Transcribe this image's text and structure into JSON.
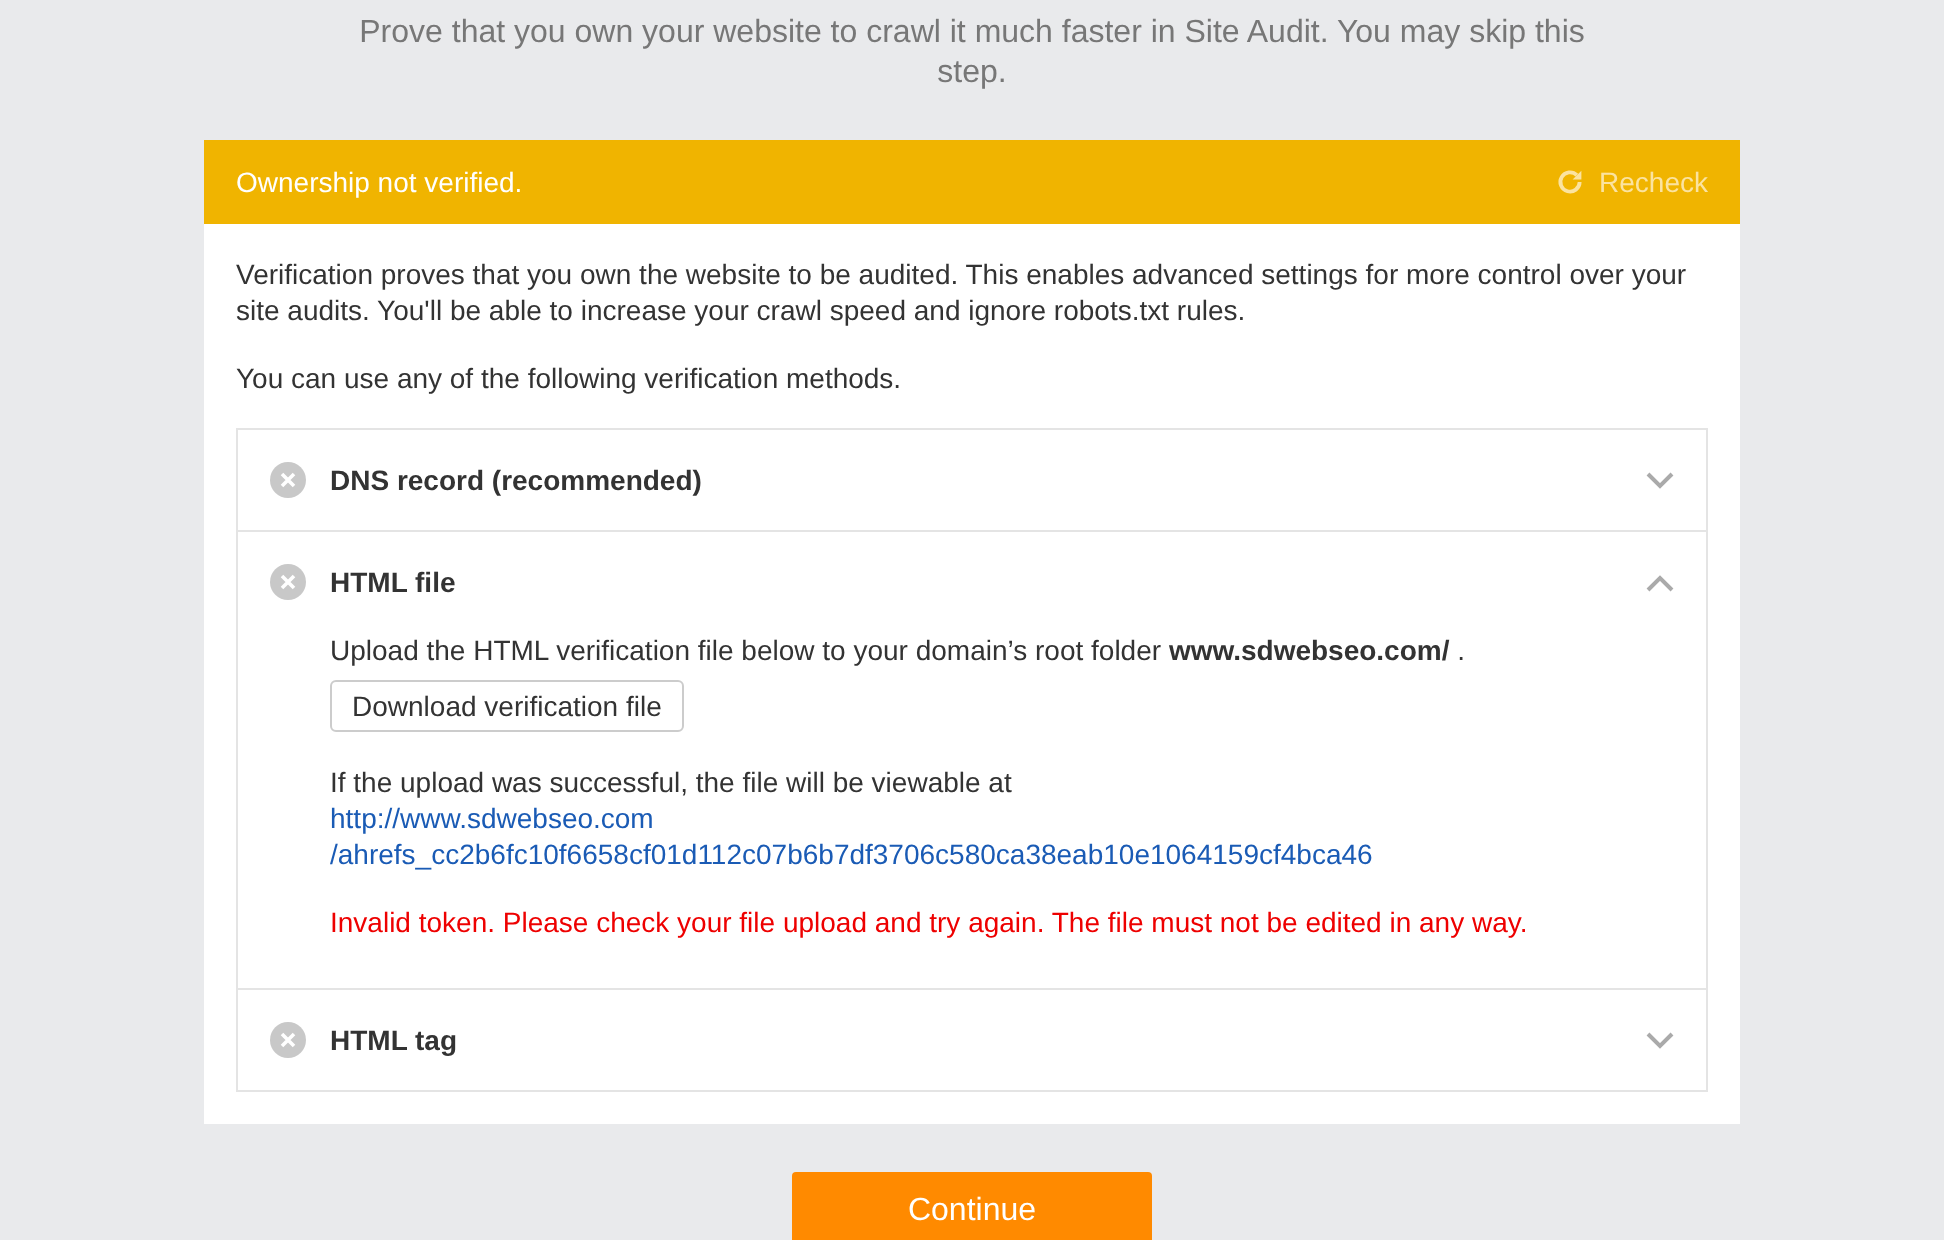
{
  "intro": "Prove that you own your website to crawl it much faster in Site Audit. You may skip this step.",
  "status_bar": {
    "text": "Ownership not verified.",
    "action": "Recheck"
  },
  "description": "Verification proves that you own the website to be audited. This enables advanced settings for more control over your site audits. You'll be able to increase your crawl speed and ignore robots.txt rules.",
  "methods_intro": "You can use any of the following verification methods.",
  "methods": [
    {
      "title": "DNS record (recommended)",
      "verified": false,
      "expanded": false
    },
    {
      "title": "HTML file",
      "verified": false,
      "expanded": true,
      "content": {
        "instruction": "Upload the HTML verification file below to your domain’s root folder **www.sdwebseo.com/** .",
        "button": "Download verification file",
        "result_text": "If the upload was successful, the file will be viewable at",
        "link_lines": [
          "http://www.sdwebseo.com",
          "/ahrefs_cc2b6fc10f6658cf01d112c07b6b7df3706c580ca38eab10e1064159cf4bca46"
        ],
        "error": "Invalid token. Please check your file upload and try again. The file must not be edited in any way."
      }
    },
    {
      "title": "HTML tag",
      "verified": false,
      "expanded": false
    }
  ],
  "continue_button": "Continue"
}
